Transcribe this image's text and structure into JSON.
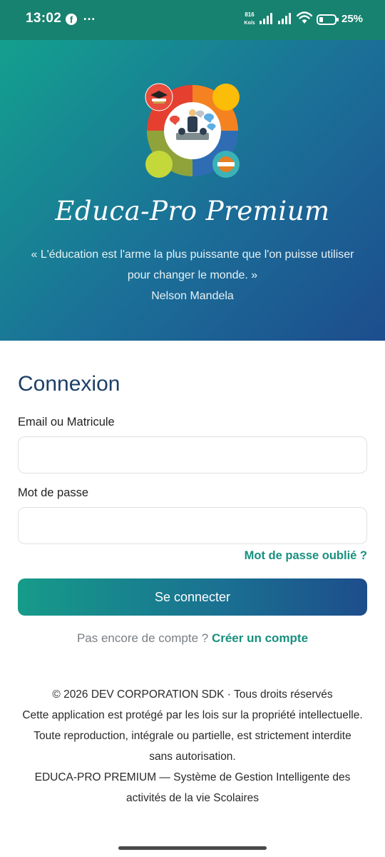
{
  "status_bar": {
    "time": "13:02",
    "facebook_icon": "facebook-icon",
    "more_icon": "…",
    "speed_value": "816",
    "speed_unit": "Ko/s",
    "battery_level": 0.25,
    "battery_text": "25%"
  },
  "hero": {
    "app_title": "Educa-Pro Premium",
    "quote": "« L'éducation est l'arme la plus puissante que l'on puisse utiliser pour changer le monde. »",
    "quote_author": "Nelson Mandela",
    "logo_colors": [
      "#e5402f",
      "#f58220",
      "#2e6db4",
      "#8fa33a"
    ]
  },
  "login": {
    "title": "Connexion",
    "email_label": "Email ou Matricule",
    "email_value": "",
    "password_label": "Mot de passe",
    "password_value": "",
    "forgot_password": "Mot de passe oublié ?",
    "submit_label": "Se connecter",
    "no_account_text": "Pas encore de compte ?",
    "create_account_link": "Créer un compte"
  },
  "footer": {
    "copyright": "© 2026 DEV CORPORATION SDK · Tous droits réservés",
    "notice": "Cette application est protégé par les lois sur la propriété intellectuelle. Toute reproduction, intégrale ou partielle, est strictement interdite sans autorisation.",
    "tagline": "EDUCA-PRO PREMIUM — Système de Gestion Intelligente des activités de la vie Scolaires"
  },
  "colors": {
    "accent": "#17907e",
    "title_blue": "#1c3f66",
    "gradient_start": "#13a08e",
    "gradient_end": "#1d4d8d"
  }
}
